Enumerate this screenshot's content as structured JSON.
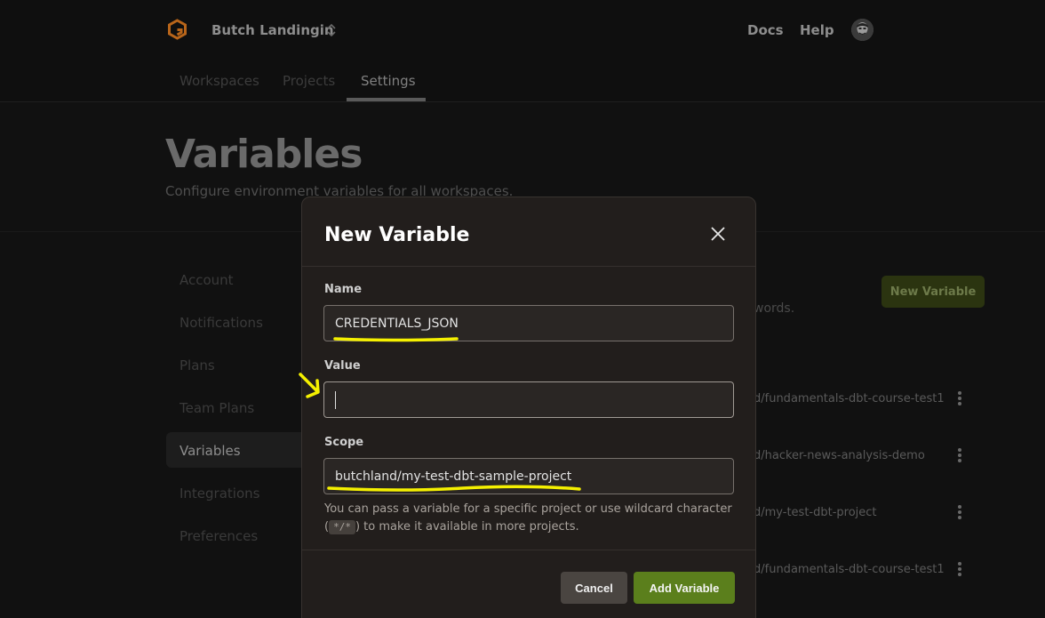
{
  "header": {
    "org_name": "Butch Landingin",
    "nav_docs": "Docs",
    "nav_help": "Help",
    "tabs": [
      {
        "label": "Workspaces",
        "active": false
      },
      {
        "label": "Projects",
        "active": false
      },
      {
        "label": "Settings",
        "active": true
      }
    ]
  },
  "page": {
    "title": "Variables",
    "subtitle": "Configure environment variables for all workspaces."
  },
  "sidebar": {
    "items": [
      {
        "label": "Account",
        "active": false
      },
      {
        "label": "Notifications",
        "active": false
      },
      {
        "label": "Plans",
        "active": false
      },
      {
        "label": "Team Plans",
        "active": false
      },
      {
        "label": "Variables",
        "active": true
      },
      {
        "label": "Integrations",
        "active": false
      },
      {
        "label": "Preferences",
        "active": false
      }
    ]
  },
  "main": {
    "new_variable_button": "New Variable",
    "hint_fragment": "words.",
    "rows": [
      {
        "scope_fragment": "d/fundamentals-dbt-course-test1"
      },
      {
        "scope_fragment": "d/hacker-news-analysis-demo"
      },
      {
        "scope_fragment": "d/my-test-dbt-project"
      },
      {
        "scope_fragment": "d/fundamentals-dbt-course-test1"
      }
    ]
  },
  "modal": {
    "title": "New Variable",
    "name_label": "Name",
    "name_value": "CREDENTIALS_JSON",
    "value_label": "Value",
    "value_value": "",
    "scope_label": "Scope",
    "scope_value": "butchland/my-test-dbt-sample-project",
    "helper_prefix": "You can pass a variable for a specific project or use wildcard character (",
    "helper_code": "*/*",
    "helper_suffix": ") to make it available in more projects.",
    "cancel_label": "Cancel",
    "add_label": "Add Variable"
  },
  "colors": {
    "accent_green": "#5b7f1c",
    "annotation_yellow": "#f5f000",
    "modal_bg": "#221e1c"
  }
}
